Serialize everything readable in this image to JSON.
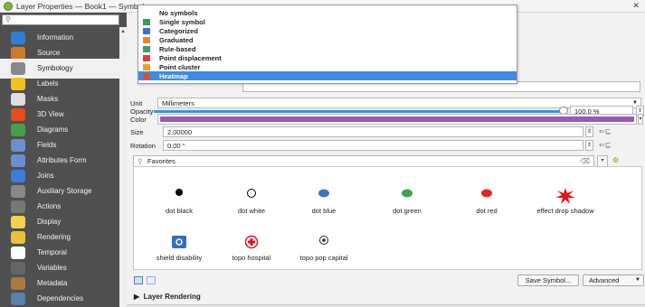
{
  "window": {
    "title": "Layer Properties — Book1 — Symbology"
  },
  "sidebar": {
    "items": [
      {
        "label": "Information",
        "icon": "info-icon",
        "color": "#2f7fd4"
      },
      {
        "label": "Source",
        "icon": "source-icon",
        "color": "#d07a2a"
      },
      {
        "label": "Symbology",
        "icon": "symbology-icon",
        "color": "#888888"
      },
      {
        "label": "Labels",
        "icon": "labels-icon",
        "color": "#f1c21b"
      },
      {
        "label": "Masks",
        "icon": "masks-icon",
        "color": "#dddddd"
      },
      {
        "label": "3D View",
        "icon": "cube-3d-icon",
        "color": "#e34d1f"
      },
      {
        "label": "Diagrams",
        "icon": "diagrams-icon",
        "color": "#45a049"
      },
      {
        "label": "Fields",
        "icon": "fields-icon",
        "color": "#6a8fd0"
      },
      {
        "label": "Attributes Form",
        "icon": "form-icon",
        "color": "#6a8fd0"
      },
      {
        "label": "Joins",
        "icon": "joins-icon",
        "color": "#3b7dd8"
      },
      {
        "label": "Auxiliary Storage",
        "icon": "storage-icon",
        "color": "#888888"
      },
      {
        "label": "Actions",
        "icon": "actions-icon",
        "color": "#777777"
      },
      {
        "label": "Display",
        "icon": "display-icon",
        "color": "#f2d24f"
      },
      {
        "label": "Rendering",
        "icon": "rendering-icon",
        "color": "#e9c23b"
      },
      {
        "label": "Temporal",
        "icon": "clock-icon",
        "color": "#ffffff"
      },
      {
        "label": "Variables",
        "icon": "variables-icon",
        "color": "#666666"
      },
      {
        "label": "Metadata",
        "icon": "metadata-icon",
        "color": "#a97a3c"
      },
      {
        "label": "Dependencies",
        "icon": "dependencies-icon",
        "color": "#5b7fae"
      }
    ],
    "selected_index": 2
  },
  "renderer_dropdown": {
    "items": [
      {
        "label": "No symbols",
        "icon": "no-symbols-icon",
        "color": "#ffffff"
      },
      {
        "label": "Single symbol",
        "icon": "single-symbol-icon",
        "color": "#2e9e50"
      },
      {
        "label": "Categorized",
        "icon": "categorized-icon",
        "color": "#3a6fd1"
      },
      {
        "label": "Graduated",
        "icon": "graduated-icon",
        "color": "#e5842b"
      },
      {
        "label": "Rule-based",
        "icon": "rule-based-icon",
        "color": "#38a169"
      },
      {
        "label": "Point displacement",
        "icon": "point-displacement-icon",
        "color": "#e23b3b"
      },
      {
        "label": "Point cluster",
        "icon": "point-cluster-icon",
        "color": "#e7a31f"
      },
      {
        "label": "Heatmap",
        "icon": "heatmap-icon",
        "color": "#e84b2a"
      }
    ],
    "selected_index": 7
  },
  "symbol_settings": {
    "unit_label": "Unit",
    "unit_value": "Millimeters",
    "opacity_label": "Opacity",
    "opacity_value": "100.0 %",
    "opacity_fraction": 1.0,
    "color_label": "Color",
    "color_value": "#9b59b6",
    "size_label": "Size",
    "size_value": "2.00000",
    "rotation_label": "Rotation",
    "rotation_value": "0.00 °"
  },
  "library": {
    "favorites_value": "Favorites",
    "symbols": [
      {
        "label": "dot  black",
        "icon": "dot-black-icon"
      },
      {
        "label": "dot  white",
        "icon": "dot-white-icon"
      },
      {
        "label": "dot blue",
        "icon": "dot-blue-icon"
      },
      {
        "label": "dot green",
        "icon": "dot-green-icon"
      },
      {
        "label": "dot red",
        "icon": "dot-red-icon"
      },
      {
        "label": "effect drop shadow",
        "icon": "effect-drop-shadow-icon"
      },
      {
        "label": "shield disability",
        "icon": "shield-disability-icon"
      },
      {
        "label": "topo hospital",
        "icon": "topo-hospital-icon"
      },
      {
        "label": "topo pop capital",
        "icon": "topo-pop-capital-icon"
      }
    ],
    "save_symbol_label": "Save Symbol...",
    "advanced_label": "Advanced"
  },
  "layer_rendering": {
    "label": "Layer Rendering"
  }
}
